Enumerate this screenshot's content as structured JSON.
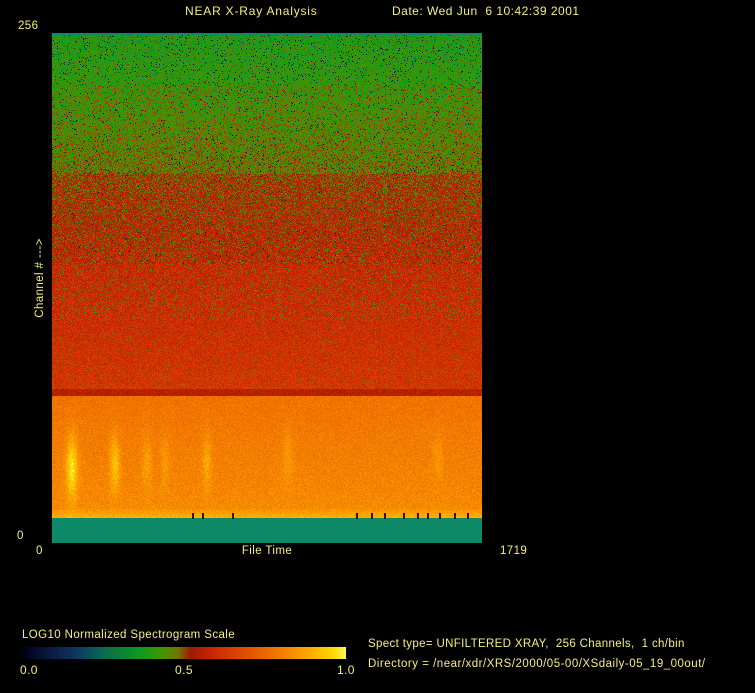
{
  "header": {
    "title": "NEAR X-Ray Analysis",
    "date": "Date: Wed Jun  6 10:42:39 2001"
  },
  "axes": {
    "y_max": "256",
    "y_min": "0",
    "x_min": "0",
    "x_max": "1719",
    "x_label": "File Time",
    "y_label": "Channel # --->"
  },
  "colorbar": {
    "label": "LOG10 Normalized Spectrogram Scale",
    "tick_low": "0.0",
    "tick_mid": "0.5",
    "tick_high": "1.0"
  },
  "info": {
    "line1": "Spect type= UNFILTERED XRAY,  256 Channels,  1 ch/bin",
    "line2": "Directory = /near/xdr/XRS/2000/05-00/XSdaily-05_19_00out/"
  },
  "colors": {
    "background": "#000000",
    "text": "#f4f07c",
    "nodata_teal": "#0e8968"
  },
  "chart_data": {
    "type": "heatmap",
    "title": "NEAR X-Ray Analysis",
    "xlabel": "File Time",
    "ylabel": "Channel #",
    "x_range": [
      0,
      1719
    ],
    "y_range": [
      0,
      256
    ],
    "scale_label": "LOG10 Normalized Spectrogram Scale",
    "scale_range": [
      0.0,
      1.0
    ],
    "scale_ticks": [
      0.0,
      0.5,
      1.0
    ],
    "legend_position": "bottom-left",
    "grid": false,
    "nodata_color": "#0e8968",
    "noise_seed": 1337,
    "colormap_stops": [
      [
        0.0,
        "#000014"
      ],
      [
        0.09,
        "#0a1c44"
      ],
      [
        0.17,
        "#0e3a60"
      ],
      [
        0.24,
        "#0c6456"
      ],
      [
        0.31,
        "#0c8534"
      ],
      [
        0.37,
        "#119c20"
      ],
      [
        0.43,
        "#3f9800"
      ],
      [
        0.48,
        "#6f7a00"
      ],
      [
        0.52,
        "#9c1c00"
      ],
      [
        0.58,
        "#c62500"
      ],
      [
        0.66,
        "#d94300"
      ],
      [
        0.74,
        "#ea6300"
      ],
      [
        0.82,
        "#f68600"
      ],
      [
        0.9,
        "#ffb100"
      ],
      [
        0.96,
        "#ffd900"
      ],
      [
        1.0,
        "#fff45c"
      ]
    ],
    "profile_segments": [
      {
        "lo": 0,
        "hi": 12.5,
        "nodata": true
      },
      {
        "lo": 12.5,
        "hi": 17,
        "v_lo": 0.9,
        "v_hi": 0.84,
        "noise": 0.03
      },
      {
        "lo": 17,
        "hi": 74,
        "v_lo": 0.825,
        "v_hi": 0.775,
        "noise": 0.035
      },
      {
        "lo": 74,
        "hi": 77.5,
        "v_lo": 0.55,
        "v_hi": 0.56,
        "noise": 0.035
      },
      {
        "lo": 77.5,
        "hi": 112,
        "v_lo": 0.625,
        "v_hi": 0.6,
        "noise": 0.045,
        "p_alt": 0.03,
        "alt_v": 0.47
      },
      {
        "lo": 112,
        "hi": 140,
        "v_lo": 0.6,
        "v_hi": 0.585,
        "noise": 0.05,
        "p_alt": 0.08,
        "alt_v": 0.45
      },
      {
        "lo": 140,
        "hi": 185,
        "v_lo": 0.575,
        "v_hi": 0.525,
        "noise": 0.065,
        "p_alt": 0.12,
        "alt_v": 0.43,
        "p_dark": 0.01
      },
      {
        "lo": 185,
        "hi": 230,
        "v_lo": 0.465,
        "v_hi": 0.415,
        "noise": 0.06,
        "p_alt": 0.1,
        "alt_v": 0.575,
        "p_dark": 0.03
      },
      {
        "lo": 230,
        "hi": 255,
        "v_lo": 0.41,
        "v_hi": 0.39,
        "noise": 0.055,
        "p_alt": 0.02,
        "alt_v": 0.57,
        "p_dark": 0.05
      },
      {
        "lo": 255,
        "hi": 257,
        "nodata": true
      }
    ],
    "streaks": [
      {
        "t": 80,
        "ch": 38,
        "amp": 0.17,
        "sigma_t": 16,
        "sigma_ch": 11
      },
      {
        "t": 252,
        "ch": 40,
        "amp": 0.12,
        "sigma_t": 14,
        "sigma_ch": 10
      },
      {
        "t": 380,
        "ch": 41,
        "amp": 0.06,
        "sigma_t": 14,
        "sigma_ch": 10
      },
      {
        "t": 452,
        "ch": 41,
        "amp": 0.05,
        "sigma_t": 12,
        "sigma_ch": 9
      },
      {
        "t": 620,
        "ch": 41,
        "amp": 0.075,
        "sigma_t": 13,
        "sigma_ch": 10
      },
      {
        "t": 943,
        "ch": 44,
        "amp": 0.05,
        "sigma_t": 16,
        "sigma_ch": 10
      },
      {
        "t": 1543,
        "ch": 44,
        "amp": 0.04,
        "sigma_t": 16,
        "sigma_ch": 9
      }
    ],
    "gap_ticks_file_time": [
      564,
      604,
      724,
      1219,
      1279,
      1331,
      1407,
      1463,
      1503,
      1551,
      1611,
      1663
    ]
  }
}
